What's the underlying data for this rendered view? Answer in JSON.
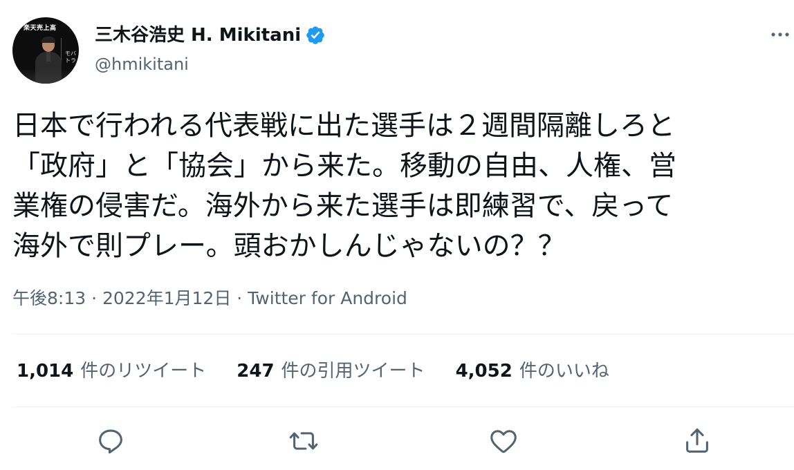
{
  "author": {
    "display_name": "三木谷浩史 H. Mikitani",
    "handle": "@hmikitani",
    "verified": true,
    "avatar_caption": "楽天売上高",
    "avatar_side_text": "モバ\nトラ"
  },
  "tweet": {
    "text": "日本で行われる代表戦に出た選手は２週間隔離しろと\n「政府」と「協会」から来た。移動の自由、人権、営\n業権の侵害だ。海外から来た選手は即練習で、戻って\n海外で則プレー。頭おかしんじゃないの？？",
    "timestamp": "午後8:13 · 2022年1月12日 · ",
    "source": "Twitter for Android"
  },
  "stats": {
    "retweets_count": "1,014",
    "retweets_label": "件のリツイート",
    "quotes_count": "247",
    "quotes_label": "件の引用ツイート",
    "likes_count": "4,052",
    "likes_label": "件のいいね"
  },
  "actions": {
    "reply_icon": "reply-icon",
    "retweet_icon": "retweet-icon",
    "like_icon": "heart-icon",
    "share_icon": "share-icon"
  },
  "colors": {
    "text": "#0f1419",
    "secondary": "#536471",
    "verified": "#1d9bf0",
    "divider": "#eff3f4"
  }
}
